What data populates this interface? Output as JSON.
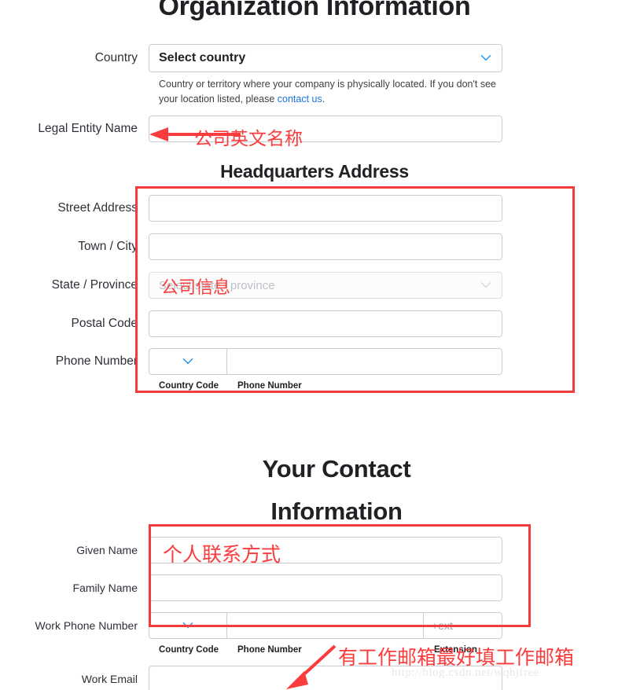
{
  "page": {
    "watermark": "http://blog.csdn.net/wqhjfree",
    "accent_blue": "#1a73e8",
    "annotation_red": "#fa3c3c"
  },
  "org_section": {
    "title": "Organization Information",
    "country": {
      "label": "Country",
      "value": "Select country",
      "chevron_icon": "chevron-down-icon",
      "help_prefix": "Country or territory where your company is physically located. If you don't see your location listed, please ",
      "help_link": "contact us",
      "help_suffix": "."
    },
    "legal_entity": {
      "label": "Legal Entity Name",
      "value": "",
      "placeholder": ""
    }
  },
  "hq_section": {
    "title": "Headquarters Address",
    "fields": [
      {
        "label": "Street Address",
        "value": "",
        "type": "text"
      },
      {
        "label": "Town / City",
        "value": "",
        "type": "text"
      },
      {
        "label": "State / Province",
        "value": "Select state / province",
        "type": "select-disabled"
      },
      {
        "label": "Postal Code",
        "value": "",
        "type": "text"
      }
    ],
    "phone": {
      "label": "Phone Number",
      "country_code_value": "",
      "phone_value": "",
      "sub_country_code": "Country Code",
      "sub_phone_number": "Phone Number",
      "chevron_icon": "chevron-down-icon"
    }
  },
  "contact_section": {
    "title_line1": "Your Contact",
    "title_line2": "Information",
    "given_name": {
      "label": "Given Name",
      "value": ""
    },
    "family_name": {
      "label": "Family Name",
      "value": ""
    },
    "work_phone": {
      "label": "Work Phone Number",
      "country_code_value": "",
      "phone_value": "",
      "extension_placeholder": "+ext",
      "sub_country_code": "Country Code",
      "sub_phone_number": "Phone Number",
      "sub_extension": "Extension",
      "chevron_icon": "chevron-down-icon"
    },
    "work_email": {
      "label": "Work Email",
      "value": ""
    }
  },
  "annotations": {
    "legal_entity_note": "公司英文名称",
    "company_info_note": "公司信息",
    "personal_contact_note": "个人联系方式",
    "work_email_note": "有工作邮箱最好填工作邮箱"
  }
}
